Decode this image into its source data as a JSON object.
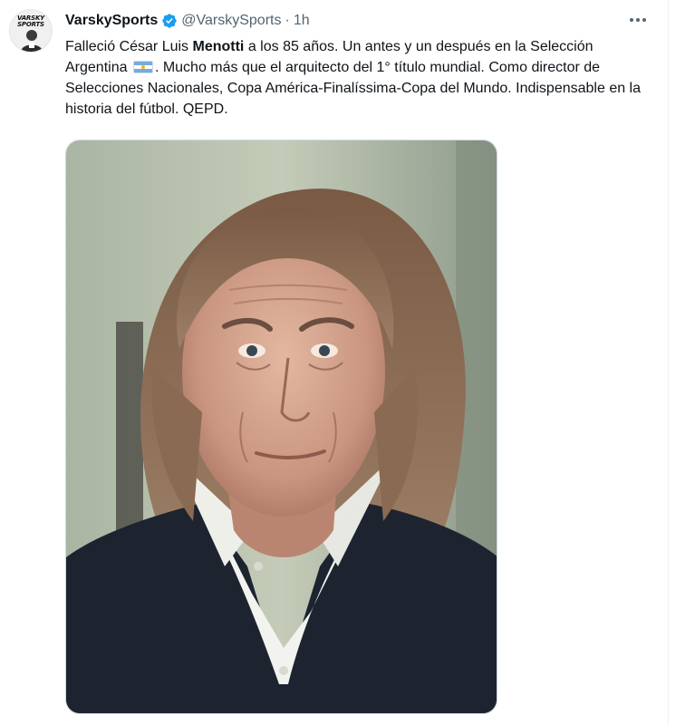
{
  "account": {
    "display_name": "VarskySports",
    "handle": "@VarskySports",
    "separator": "·",
    "time": "1h",
    "avatar_logo": "VARSKY SPORTS",
    "verified_icon": "verified-badge-icon",
    "verified_color": "#1d9bf0"
  },
  "tweet": {
    "text_part1": "Falleció César Luis ",
    "text_bold": "Menotti",
    "text_part2": " a los 85 años. Un antes y un después en la Selección Argentina ",
    "flag_icon": "argentina-flag-icon",
    "text_part3": ". Mucho más que el arquitecto del 1° título mundial. Como director de Selecciones Nacionales, Copa América-Finalíssima-Copa del Mundo. Indispensable en la historia del fútbol. QEPD."
  },
  "more_icon": "more-options-icon",
  "colors": {
    "primary_text": "#0f1419",
    "secondary_text": "#536471",
    "accent": "#1d9bf0"
  }
}
